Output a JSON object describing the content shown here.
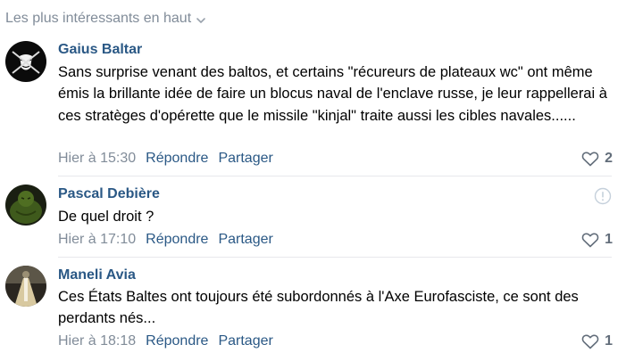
{
  "sort": {
    "label": "Les plus intéressants en haut",
    "icon": "chevron-down-icon"
  },
  "comments": [
    {
      "author": "Gaius Baltar",
      "text": "Sans surprise venant des baltos, et certains \"récureurs de plateaux wc\" ont même émis la brillante idée de faire un blocus naval de l'enclave russe, je leur rappellerai à ces stratèges d'opérette que le missile \"kinjal\" traite aussi les cibles navales......",
      "time": "Hier à 15:30",
      "reply_label": "Répondre",
      "share_label": "Partager",
      "likes": "2"
    },
    {
      "author": "Pascal Debière",
      "text": "De quel droit ?",
      "time": "Hier à 17:10",
      "reply_label": "Répondre",
      "share_label": "Partager",
      "likes": "1"
    },
    {
      "author": "Maneli Avia",
      "text": "Ces États Baltes ont toujours été subordonnés à l'Axe Eurofasciste, ce sont des perdants nés...",
      "time": "Hier à 18:18",
      "reply_label": "Répondre",
      "share_label": "Partager",
      "likes": "1"
    }
  ],
  "colors": {
    "link": "#2a5885",
    "muted": "#818c99",
    "divider": "#e7e8ec"
  }
}
